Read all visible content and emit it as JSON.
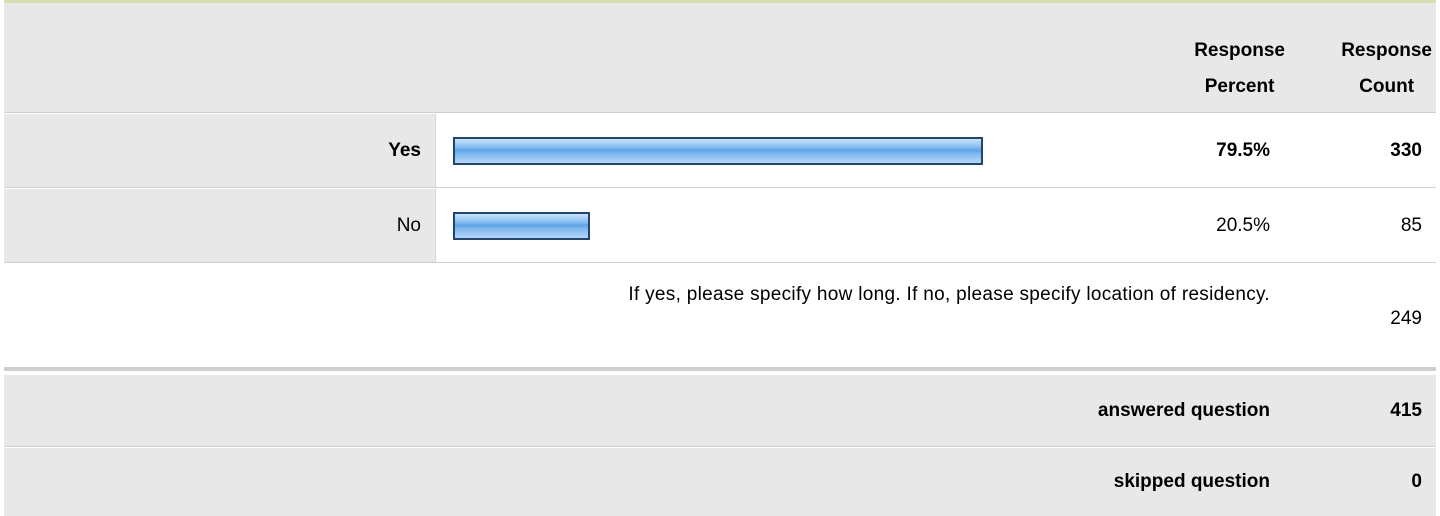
{
  "header": {
    "percent_label_line1": "Response",
    "percent_label_line2": "Percent",
    "count_label_line1": "Response",
    "count_label_line2": "Count"
  },
  "options": [
    {
      "label": "Yes",
      "percent_text": "79.5%",
      "count": "330",
      "percent": 0.795
    },
    {
      "label": "No",
      "percent_text": "20.5%",
      "count": "85",
      "percent": 0.205
    }
  ],
  "open_ended": {
    "prompt": "If yes, please specify how long. If no, please specify location of residency.",
    "count": "249"
  },
  "summary": {
    "answered_label": "answered question",
    "answered_count": "415",
    "skipped_label": "skipped question",
    "skipped_count": "0"
  },
  "colors": {
    "bar_border": "#23456b",
    "bar_fill": "#5ea3e6",
    "header_bg": "#e8e8e8",
    "top_border": "#d4dfb2"
  }
}
